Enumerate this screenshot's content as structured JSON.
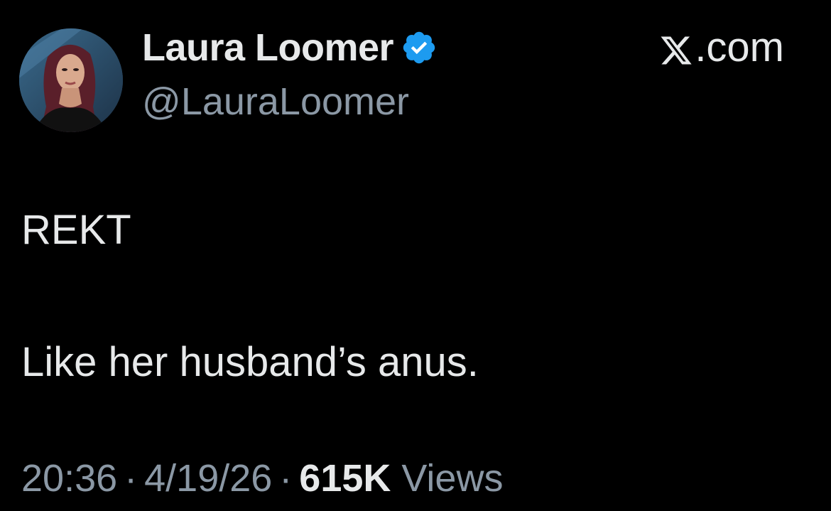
{
  "author": {
    "display_name": "Laura Loomer",
    "handle": "@LauraLoomer",
    "verified_icon": "verified-badge-icon",
    "verified_color": "#1d9bf0"
  },
  "brand": {
    "logo_icon": "x-logo-icon",
    "suffix": ".com"
  },
  "tweet": {
    "line1": "REKT",
    "line2": "Like her husband’s anus."
  },
  "meta": {
    "time": "20:36",
    "separator": "·",
    "date": "4/19/26",
    "views_count": "615K",
    "views_label": "Views"
  },
  "colors": {
    "background": "#000000",
    "primary_text": "#e7e9ea",
    "secondary_text": "#8b98a5"
  }
}
